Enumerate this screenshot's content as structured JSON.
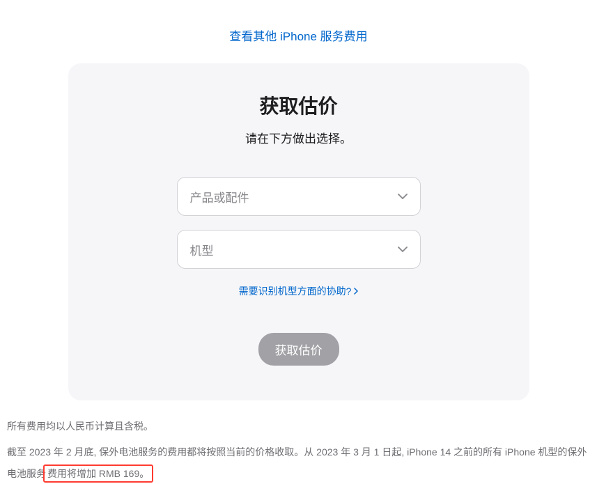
{
  "topLink": {
    "text": "查看其他 iPhone 服务费用"
  },
  "card": {
    "title": "获取估价",
    "subtitle": "请在下方做出选择。",
    "select1": {
      "placeholder": "产品或配件"
    },
    "select2": {
      "placeholder": "机型"
    },
    "helpLink": "需要识别机型方面的协助?",
    "submitLabel": "获取估价"
  },
  "footer": {
    "note1": "所有费用均以人民币计算且含税。",
    "note2_part1": "截至 2023 年 2 月底, 保外电池服务的费用都将按照当前的价格收取。从 2023 年 3 月 1 日起, iPhone 14 之前的所有 iPhone 机型的保外电池服务",
    "note2_highlight": "费用将增加 RMB 169。"
  }
}
